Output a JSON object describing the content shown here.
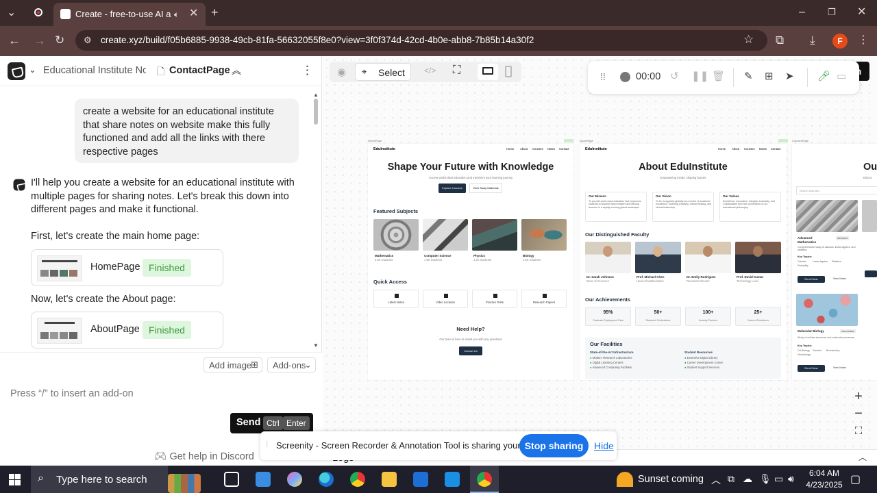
{
  "browser": {
    "tab_title": "Create - free-to-use AI app",
    "url": "create.xyz/build/f05b6885-9938-49cb-81fa-56632055f8e0?view=3f0f374d-42cd-4b0e-abb8-7b85b14a30f2",
    "profile_initial": "F"
  },
  "left": {
    "project_name": "Educational Institute Nc",
    "page_name": "ContactPage",
    "user_prompt": "create a website for an educational institute that share notes on website make this fully functioned and add all the links with there respective pages",
    "assistant_intro": "I'll help you create a website for an educational institute with multiple pages for sharing notes. Let's break this down into different pages and make it functional.",
    "step1": "First, let's create the main home page:",
    "card1": {
      "name": "HomePage",
      "status": "Finished"
    },
    "step2": "Now, let's create the About page:",
    "card2": {
      "name": "AboutPage",
      "status": "Finished"
    },
    "add_image": "Add image",
    "addons": "Add-ons",
    "input_placeholder": "Press “/” to insert an add-on",
    "send": "Send",
    "key_ctrl": "Ctrl",
    "key_enter": "Enter",
    "discord": "Get help in Discord"
  },
  "canvas_toolbar": {
    "select": "Select",
    "publish_partial": "sh",
    "timer": "00:00"
  },
  "mock_home": {
    "label": "HomePage",
    "brand": "EduInstitute",
    "nav": [
      "Home",
      "About",
      "Courses",
      "Notes",
      "Contact"
    ],
    "hero": "Shape Your Future with Knowledge",
    "hero_sub": "Access world-class education and transform your learning journey",
    "btn1": "Explore Courses",
    "btn2": "View Study Materials",
    "featured": "Featured Subjects",
    "subjects": [
      {
        "name": "Mathematics",
        "count": "2.5K Students"
      },
      {
        "name": "Computer Science",
        "count": "1.8K Students"
      },
      {
        "name": "Physics",
        "count": "1.2K Students"
      },
      {
        "name": "Biology",
        "count": "1.5K Students"
      }
    ],
    "quick": "Quick Access",
    "quick_items": [
      "Latest Notes",
      "Video Lectures",
      "Practice Tests",
      "Research Papers"
    ],
    "help_title": "Need Help?",
    "help_sub": "Our team is here to assist you with any questions",
    "help_btn": "Contact Us"
  },
  "mock_about": {
    "label": "AboutPage",
    "brand": "EduInstitute",
    "nav": [
      "Home",
      "About",
      "Courses",
      "Notes",
      "Contact"
    ],
    "title": "About EduInstitute",
    "subtitle": "Empowering minds, shaping futures",
    "cards": [
      {
        "title": "Our Mission",
        "text": "To provide world-class education that empowers students to become future leaders and lifelong learners in a rapidly evolving global landscape."
      },
      {
        "title": "Our Vision",
        "text": "To be recognized globally as a center of academic excellence, fostering creativity, critical thinking, and ethical leadership."
      },
      {
        "title": "Our Values",
        "text": "Excellence, Innovation, Integrity, Inclusivity, and Collaboration form the cornerstone of our educational philosophy."
      }
    ],
    "faculty_title": "Our Distinguished Faculty",
    "faculty": [
      {
        "name": "Dr. Sarah Johnson",
        "role": "Dean of Sciences"
      },
      {
        "name": "Prof. Michael Chen",
        "role": "Head of Mathematics"
      },
      {
        "name": "Dr. Emily Rodriguez",
        "role": "Research Director"
      },
      {
        "name": "Prof. David Kumar",
        "role": "Technology Lead"
      }
    ],
    "ach_title": "Our Achievements",
    "achievements": [
      {
        "num": "95%",
        "label": "Graduate Employment Rate"
      },
      {
        "num": "50+",
        "label": "Research Publications"
      },
      {
        "num": "100+",
        "label": "Industry Partners"
      },
      {
        "num": "25+",
        "label": "Years of Excellence"
      }
    ],
    "facilities_title": "Our Facilities",
    "infra_title": "State-of-the-Art Infrastructure",
    "infra": [
      "Modern Research Laboratories",
      "Digital Learning Centers",
      "Advanced Computing Facilities"
    ],
    "res_title": "Student Resources",
    "resources": [
      "Extensive Digital Library",
      "Career Development Center",
      "Student Support Services"
    ]
  },
  "mock_courses": {
    "label": "CoursesPage",
    "title_partial": "Ou",
    "sub_partial": "Discov",
    "search": "Search courses...",
    "course1": {
      "name": "Advanced Mathematics",
      "level": "Advanced",
      "desc": "Comprehensive study of calculus, linear algebra, and statistics",
      "topics_label": "Key Topics:",
      "topics": [
        "Calculus",
        "Linear Algebra",
        "Statistics",
        "Probability"
      ],
      "btn1": "Enroll Now",
      "btn2": "View Notes"
    },
    "course2": {
      "name": "Molecular Biology",
      "level": "Intermediate",
      "desc": "Study of cellular structures and molecular processes",
      "topics_label": "Key Topics:",
      "topics": [
        "Cell Biology",
        "Genetics",
        "Biochemistry",
        "Microbiology"
      ],
      "btn1": "Enroll Now",
      "btn2": "View Notes"
    }
  },
  "share_bar": {
    "text": "Screenity - Screen Recorder & Annotation Tool is sharing your screen.",
    "stop": "Stop sharing",
    "hide": "Hide"
  },
  "bottom_bar": {
    "logs": "Logs"
  },
  "taskbar": {
    "search": "Type here to search",
    "weather": "Sunset coming",
    "time": "6:04 AM",
    "date": "4/23/2025"
  }
}
